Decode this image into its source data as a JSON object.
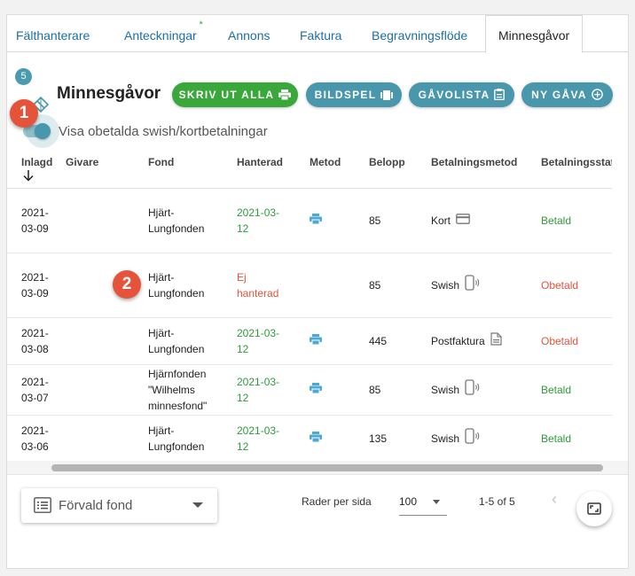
{
  "tabs": [
    {
      "label": "Fälthanterare"
    },
    {
      "label": "Anteckningar",
      "dot": "*"
    },
    {
      "label": "Annons"
    },
    {
      "label": "Faktura"
    },
    {
      "label": "Begravningsflöde"
    },
    {
      "label": "Minnesgåvor",
      "active": true
    }
  ],
  "header": {
    "badge_count": "5",
    "title": "Minnesgåvor",
    "buttons": {
      "print_all": "SKRIV UT ALLA",
      "slideshow": "BILDSPEL",
      "gift_list": "GÅVOLISTA",
      "new_gift": "NY GÅVA"
    }
  },
  "markers": {
    "one": "1",
    "two": "2"
  },
  "toggle": {
    "label": "Visa obetalda swish/kortbetalningar",
    "on": true
  },
  "table": {
    "columns": [
      "Inlagd",
      "Givare",
      "Fond",
      "Hanterad",
      "Metod",
      "Belopp",
      "Betalningsmetod",
      "Betalningsstatu"
    ],
    "rows": [
      {
        "date_a": "2021-",
        "date_b": "03-09",
        "givare": "",
        "fond_lines": [
          "Hjärt-",
          "Lungfonden"
        ],
        "handled_a": "2021-03-",
        "handled_b": "12",
        "handled_status": "green",
        "method_icon": "print-icon",
        "amount": "85",
        "payment_method": "Kort",
        "payment_icon": "card-icon",
        "status": "Betald",
        "status_color": "#2e9c3a"
      },
      {
        "date_a": "2021-",
        "date_b": "03-09",
        "givare": "",
        "fond_lines": [
          "Hjärt-",
          "Lungfonden"
        ],
        "handled_a": "Ej",
        "handled_b": "hanterad",
        "handled_status": "red",
        "method_icon": "",
        "amount": "85",
        "payment_method": "Swish",
        "payment_icon": "phone-icon",
        "status": "Obetald",
        "status_color": "#e5533b"
      },
      {
        "date_a": "2021-",
        "date_b": "03-08",
        "givare": "",
        "fond_lines": [
          "Hjärt-",
          "Lungfonden"
        ],
        "handled_a": "2021-03-",
        "handled_b": "12",
        "handled_status": "green",
        "method_icon": "print-icon",
        "amount": "445",
        "payment_method": "Postfaktura",
        "payment_icon": "document-icon",
        "status": "Obetald",
        "status_color": "#e5533b"
      },
      {
        "date_a": "2021-",
        "date_b": "03-07",
        "givare": "",
        "fond_lines": [
          "Hjärnfonden",
          "\"Wilhelms",
          "minnesfond\""
        ],
        "handled_a": "2021-03-",
        "handled_b": "12",
        "handled_status": "green",
        "method_icon": "print-icon",
        "amount": "85",
        "payment_method": "Swish",
        "payment_icon": "phone-icon",
        "status": "Betald",
        "status_color": "#2e9c3a"
      },
      {
        "date_a": "2021-",
        "date_b": "03-06",
        "givare": "",
        "fond_lines": [
          "Hjärt-",
          "Lungfonden"
        ],
        "handled_a": "2021-03-",
        "handled_b": "12",
        "handled_status": "green",
        "method_icon": "print-icon",
        "amount": "135",
        "payment_method": "Swish",
        "payment_icon": "phone-icon",
        "status": "Betald",
        "status_color": "#2e9c3a"
      }
    ]
  },
  "footer": {
    "fund_select": "Förvald fond",
    "rows_per_page_label": "Rader per sida",
    "rows_per_page_value": "100",
    "range": "1-5 of 5"
  },
  "colors": {
    "green": "#3aa73a",
    "teal": "#4897ad",
    "link": "#1d6fa8",
    "paid": "#2e9c3a",
    "unpaid": "#e5533b"
  }
}
